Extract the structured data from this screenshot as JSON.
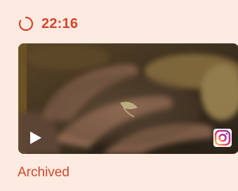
{
  "post": {
    "time": "22:16",
    "status": "Archived",
    "media_type": "video",
    "platform_icon": "instagram-icon",
    "loading_icon": "spinner-icon"
  },
  "colors": {
    "background": "#fdebe1",
    "accent": "#d5452b",
    "media_frame": "#4a3a1f"
  }
}
